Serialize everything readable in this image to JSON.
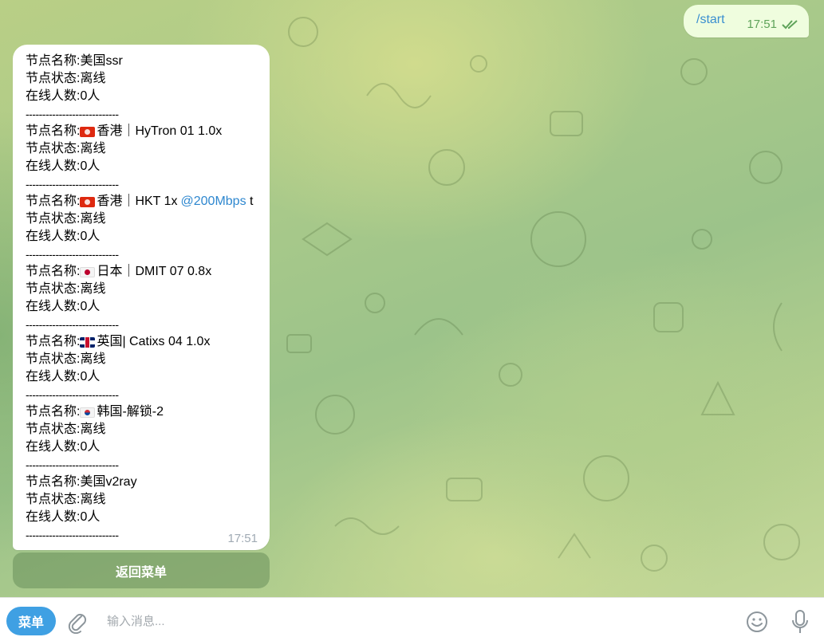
{
  "sent_message": {
    "text": "/start",
    "time": "17:51",
    "status_icon": "double-check-icon"
  },
  "received_message": {
    "time": "17:51",
    "separator": "----------------------------",
    "nodes": [
      {
        "name_prefix": "节点名称:",
        "flag": "",
        "name": "美国ssr",
        "link": "",
        "suffix": "",
        "status": "节点状态:离线",
        "online": "在线人数:0人"
      },
      {
        "name_prefix": "节点名称:",
        "flag": "hk",
        "name": "香港｜HyTron 01 1.0x",
        "link": "",
        "suffix": "",
        "status": "节点状态:离线",
        "online": "在线人数:0人"
      },
      {
        "name_prefix": "节点名称:",
        "flag": "hk",
        "name": "香港｜HKT 1x",
        "link": "@200Mbps",
        "suffix": " t",
        "status": "节点状态:离线",
        "online": "在线人数:0人"
      },
      {
        "name_prefix": "节点名称:",
        "flag": "jp",
        "name": "日本｜DMIT 07 0.8x",
        "link": "",
        "suffix": "",
        "status": "节点状态:离线",
        "online": "在线人数:0人"
      },
      {
        "name_prefix": "节点名称:",
        "flag": "gb",
        "name": "英国| Catixs 04 1.0x",
        "link": "",
        "suffix": "",
        "status": "节点状态:离线",
        "online": "在线人数:0人"
      },
      {
        "name_prefix": "节点名称:",
        "flag": "kr",
        "name": " 韩国-解锁-2",
        "link": "",
        "suffix": "",
        "status": "节点状态:离线",
        "online": "在线人数:0人"
      },
      {
        "name_prefix": "节点名称:",
        "flag": "",
        "name": "美国v2ray",
        "link": "",
        "suffix": "",
        "status": "节点状态:离线",
        "online": "在线人数:0人"
      }
    ]
  },
  "inline_button": {
    "label": "返回菜单"
  },
  "input_bar": {
    "menu_label": "菜单",
    "placeholder": "输入消息...",
    "icons": [
      "paperclip-icon",
      "emoji-icon",
      "microphone-icon"
    ]
  },
  "colors": {
    "accent": "#3fa0e3",
    "link": "#2e87cf",
    "sent_bubble": "#effdde",
    "check": "#5fa35a"
  }
}
